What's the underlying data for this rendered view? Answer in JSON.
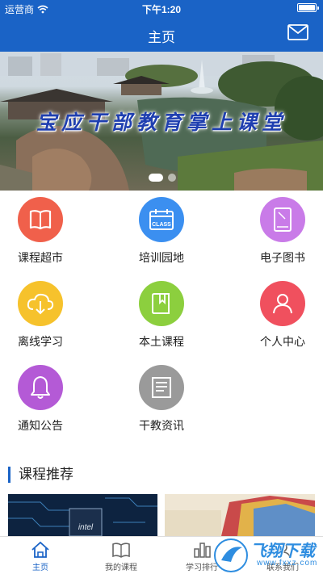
{
  "status_bar": {
    "carrier": "运营商",
    "time": "下午1:20"
  },
  "header": {
    "title": "主页",
    "mail_icon": "mail-icon"
  },
  "banner": {
    "slogan": "宝应干部教育掌上课堂",
    "slides": 2,
    "active_slide": 1
  },
  "menu": [
    {
      "label": "课程超市",
      "icon": "book-icon",
      "color": "#f0604b"
    },
    {
      "label": "培训园地",
      "icon": "calendar-class-icon",
      "icon_text": "CLASS",
      "color": "#3b8ff0"
    },
    {
      "label": "电子图书",
      "icon": "tablet-icon",
      "color": "#c97be8"
    },
    {
      "label": "离线学习",
      "icon": "cloud-download-icon",
      "color": "#f6c22c"
    },
    {
      "label": "本土课程",
      "icon": "bookmark-book-icon",
      "color": "#8ccf3e"
    },
    {
      "label": "个人中心",
      "icon": "user-icon",
      "color": "#f0505e"
    },
    {
      "label": "通知公告",
      "icon": "bell-icon",
      "color": "#b45ad6"
    },
    {
      "label": "干教资讯",
      "icon": "news-icon",
      "color": "#9a9a9a"
    }
  ],
  "section": {
    "title": "课程推荐"
  },
  "tabbar": {
    "tabs": [
      {
        "label": "主页",
        "icon": "home-icon",
        "active": true
      },
      {
        "label": "我的课程",
        "icon": "open-book-icon",
        "active": false
      },
      {
        "label": "学习排行",
        "icon": "bar-chart-icon",
        "active": false
      },
      {
        "label": "联系我们",
        "icon": "contact-icon",
        "active": false
      }
    ]
  },
  "watermark": {
    "text": "飞翔下载",
    "sub": "www.fxxz.com"
  },
  "colors": {
    "primary": "#1a63c6"
  }
}
